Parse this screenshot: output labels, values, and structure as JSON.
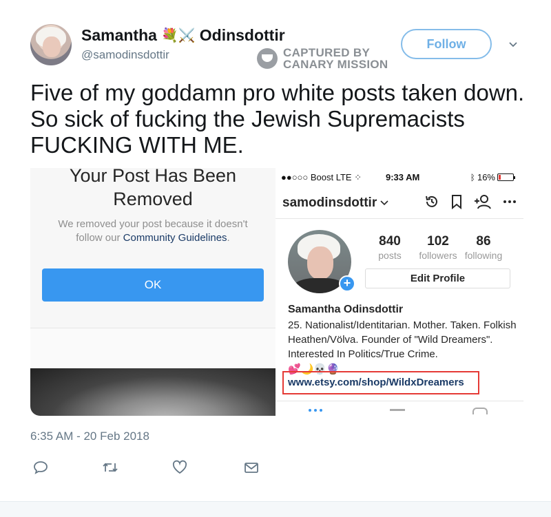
{
  "tweet": {
    "display_name_first": "Samantha",
    "display_name_emoji": "💐⚔️",
    "display_name_last": "Odinsdottir",
    "handle": "@samodinsdottir",
    "follow_label": "Follow",
    "text": "Five of my goddamn pro white posts taken down. So sick of fucking the Jewish Supremacists FUCKING WITH ME.",
    "timestamp": "6:35 AM - 20 Feb 2018",
    "actions": [
      "reply-icon",
      "retweet-icon",
      "like-icon",
      "direct-message-icon"
    ]
  },
  "watermark": {
    "line1": "CAPTURED BY",
    "line2": "CANARY MISSION"
  },
  "left_screenshot": {
    "title": "Your Post Has Been\nRemoved",
    "desc_prefix": "We removed your post because it doesn't follow our ",
    "desc_link": "Community Guidelines",
    "desc_suffix": ".",
    "ok_label": "OK"
  },
  "right_screenshot": {
    "status": {
      "carrier": "●●○○○ Boost  LTE  ⁘",
      "time": "9:33 AM",
      "battery": "16%",
      "battery_level": 0.16
    },
    "username": "samodinsdottir",
    "stats": [
      {
        "num": "840",
        "label": "posts"
      },
      {
        "num": "102",
        "label": "followers"
      },
      {
        "num": "86",
        "label": "following"
      }
    ],
    "edit_profile_label": "Edit Profile",
    "bio_name": "Samantha Odinsdottir",
    "bio_text": "25. Nationalist/Identitarian. Mother. Taken. Folkish Heathen/Völva. Founder of \"Wild Dreamers\". Interested In Politics/True Crime.",
    "bio_emoji": "💕🌙💀🔮",
    "bio_link": "www.etsy.com/shop/WildxDreamers"
  },
  "colors": {
    "twitter_blue": "#1da1f2",
    "follow_border": "#84bce9",
    "instagram_blue": "#3897f0",
    "highlight_red": "#e53935"
  }
}
